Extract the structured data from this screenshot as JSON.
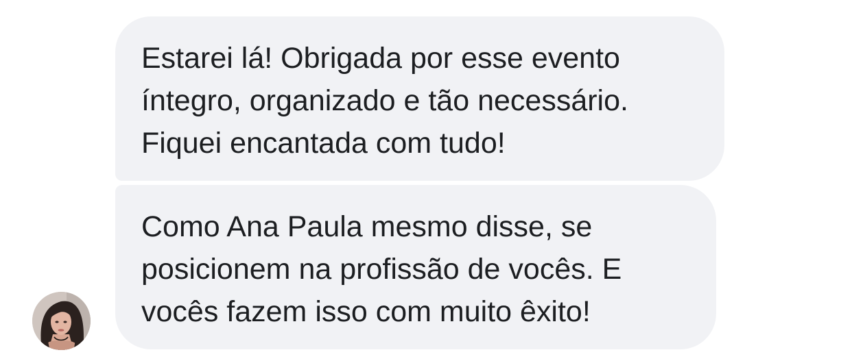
{
  "conversation": {
    "messages": [
      {
        "text": "Estarei lá! Obrigada por esse evento\níntegro, organizado e tão necessário.\nFiquei encantada com tudo!"
      },
      {
        "text": "Como Ana Paula mesmo disse, se\nposicionem na profissão de vocês. E\nvocês fazem isso com muito êxito!"
      }
    ],
    "sender": {
      "avatar_icon": "user-avatar-photo"
    }
  },
  "colors": {
    "bubble_background": "#f1f2f5",
    "text": "#1c1e21",
    "page_background": "#ffffff"
  }
}
